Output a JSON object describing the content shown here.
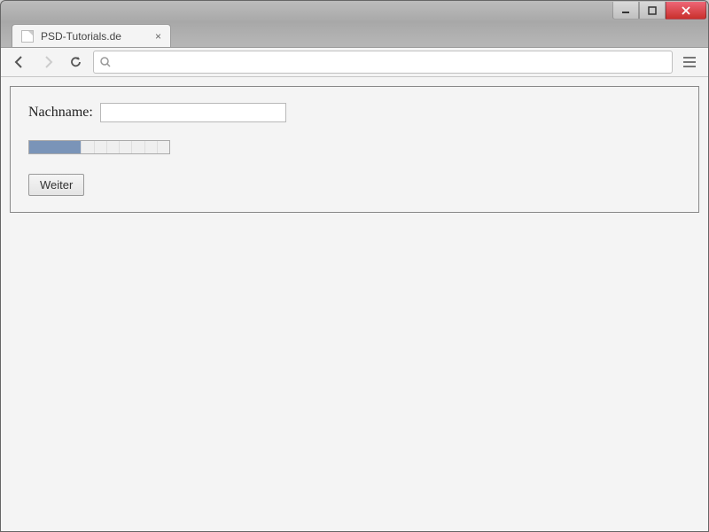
{
  "window": {
    "tab_title": "PSD-Tutorials.de"
  },
  "toolbar": {
    "url": ""
  },
  "form": {
    "nachname_label": "Nachname:",
    "nachname_value": "",
    "progress_percent": 37,
    "submit_label": "Weiter"
  }
}
